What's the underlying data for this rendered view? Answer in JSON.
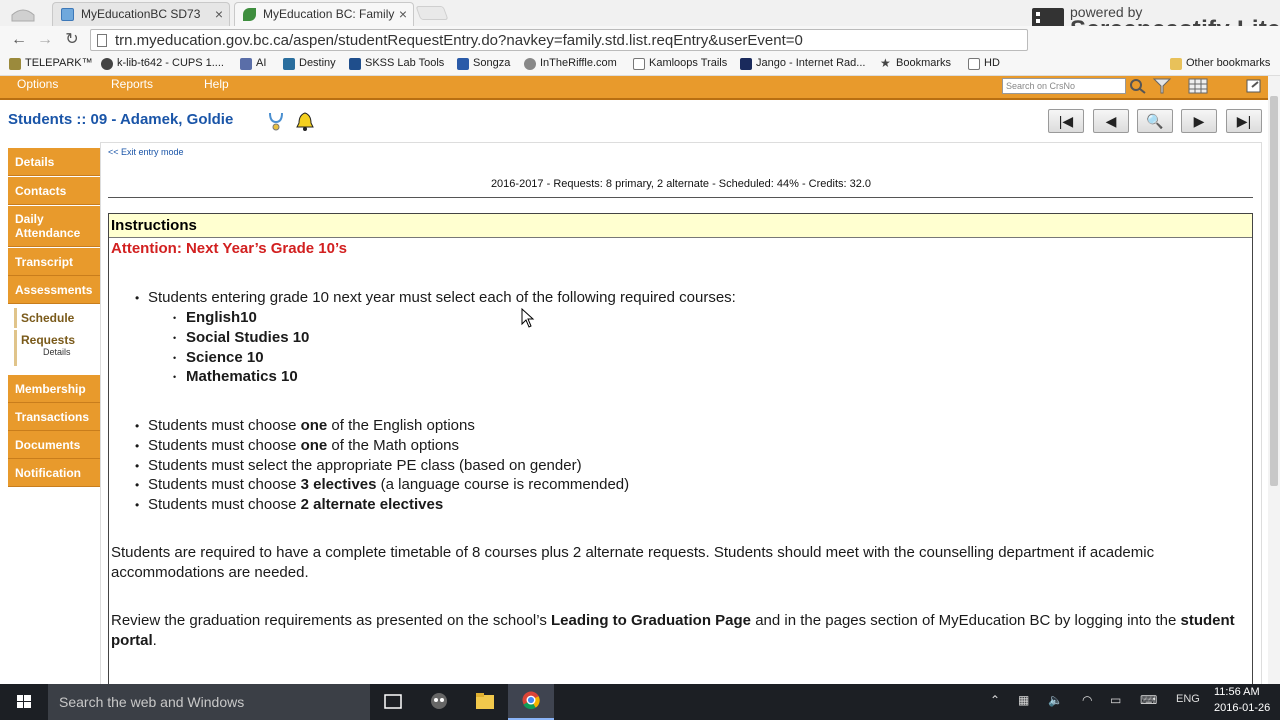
{
  "browser": {
    "tabs": [
      {
        "title": "MyEducationBC SD73"
      },
      {
        "title": "MyEducation BC: Family"
      }
    ],
    "url": "trn.myeducation.gov.bc.ca/aspen/studentRequestEntry.do?navkey=family.std.list.reqEntry&userEvent=0",
    "bookmarks": [
      "TELEPARK™",
      "k-lib-t642 - CUPS 1....",
      "AI",
      "Destiny",
      "SKSS Lab Tools",
      "Songza",
      "InTheRiffle.com",
      "Kamloops Trails",
      "Jango - Internet Rad...",
      "Bookmarks",
      "HD"
    ],
    "other_bookmarks": "Other bookmarks"
  },
  "watermark": {
    "powered_by": "powered by",
    "name": "Screencastify Lite"
  },
  "app": {
    "menu": [
      "Options",
      "Reports",
      "Help"
    ],
    "search_placeholder": "Search on CrsNo",
    "title": "Students :: 09 - Adamek, Goldie",
    "record_nav": [
      "|◀",
      "◀",
      "🔍",
      "▶",
      "▶|"
    ]
  },
  "sidenav": {
    "details": "Details",
    "contacts": "Contacts",
    "daily_attendance": "Daily Attendance",
    "transcript": "Transcript",
    "assessments": "Assessments",
    "schedule": "Schedule",
    "requests": "Requests",
    "requests_details": "Details",
    "membership": "Membership",
    "transactions": "Transactions",
    "documents": "Documents",
    "notification": "Notification"
  },
  "main": {
    "exit_link": "<< Exit entry mode",
    "summary": "2016-2017 - Requests: 8 primary, 2 alternate - Scheduled: 44% - Credits: 32.0",
    "instructions_header": "Instructions",
    "attention": "Attention: Next Year’s Grade 10’s",
    "required_intro": "Students entering grade 10 next year must select each of the following required courses:",
    "required_courses": [
      "English10",
      "Social Studies 10",
      "Science 10",
      "Mathematics 10"
    ],
    "rules": [
      {
        "pre": "Students must choose ",
        "bold": "one",
        "post": " of the English options"
      },
      {
        "pre": "Students must choose ",
        "bold": "one",
        "post": " of the Math options"
      },
      {
        "pre": "Students must select the appropriate PE class (based on gender)",
        "bold": "",
        "post": ""
      },
      {
        "pre": "Students must choose ",
        "bold": "3 electives",
        "post": " (a language course is recommended)"
      },
      {
        "pre": "Students must choose ",
        "bold": "2 alternate electives",
        "post": ""
      }
    ],
    "para1": "Students are required to have a complete timetable of 8 courses plus 2 alternate requests.  Students should meet with the counselling department if academic accommodations are needed.",
    "para2_pre": "Review the graduation requirements as presented on the school’s ",
    "para2_bold1": "Leading to Graduation Page",
    "para2_mid": " and in the pages section of MyEducation BC by logging into the ",
    "para2_bold2": "student portal",
    "para2_post": "."
  },
  "taskbar": {
    "search_placeholder": "Search the web and Windows",
    "language": "ENG",
    "time": "11:56 AM",
    "date": "2016-01-26"
  }
}
